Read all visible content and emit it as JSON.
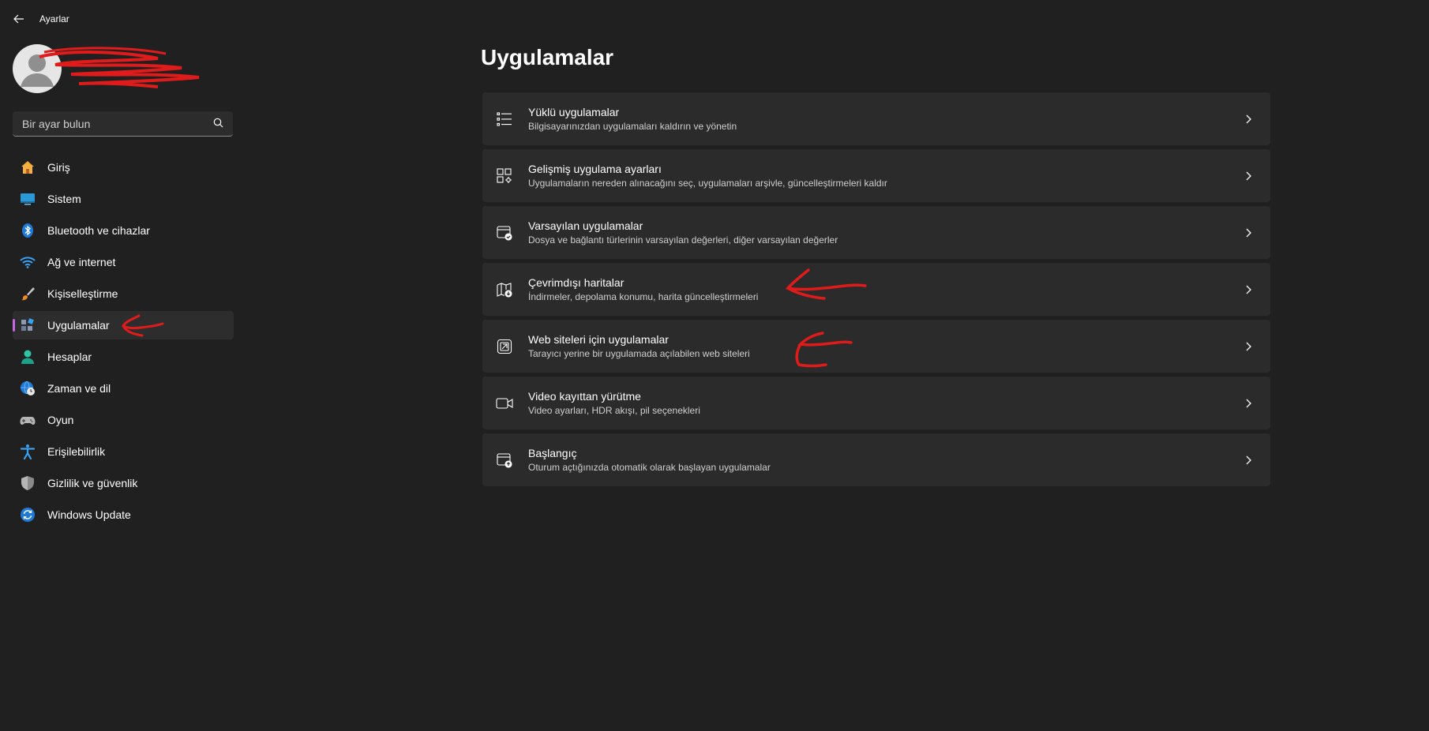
{
  "window": {
    "title": "Ayarlar"
  },
  "search": {
    "placeholder": "Bir ayar bulun"
  },
  "sidebar": {
    "items": [
      {
        "label": "Giriş",
        "icon": "home-icon"
      },
      {
        "label": "Sistem",
        "icon": "monitor-icon"
      },
      {
        "label": "Bluetooth ve cihazlar",
        "icon": "bluetooth-icon"
      },
      {
        "label": "Ağ ve internet",
        "icon": "wifi-icon"
      },
      {
        "label": "Kişiselleştirme",
        "icon": "brush-icon"
      },
      {
        "label": "Uygulamalar",
        "icon": "apps-icon",
        "selected": true
      },
      {
        "label": "Hesaplar",
        "icon": "person-icon"
      },
      {
        "label": "Zaman ve dil",
        "icon": "globe-clock-icon"
      },
      {
        "label": "Oyun",
        "icon": "gamepad-icon"
      },
      {
        "label": "Erişilebilirlik",
        "icon": "accessibility-icon"
      },
      {
        "label": "Gizlilik ve güvenlik",
        "icon": "shield-icon"
      },
      {
        "label": "Windows Update",
        "icon": "sync-icon"
      }
    ]
  },
  "main": {
    "title": "Uygulamalar",
    "cards": [
      {
        "title": "Yüklü uygulamalar",
        "desc": "Bilgisayarınızdan uygulamaları kaldırın ve yönetin",
        "icon": "list-icon"
      },
      {
        "title": "Gelişmiş uygulama ayarları",
        "desc": "Uygulamaların nereden alınacağını seç, uygulamaları arşivle, güncelleştirmeleri kaldır",
        "icon": "apps-settings-icon"
      },
      {
        "title": "Varsayılan uygulamalar",
        "desc": "Dosya ve bağlantı türlerinin varsayılan değerleri, diğer varsayılan değerler",
        "icon": "default-apps-icon"
      },
      {
        "title": "Çevrimdışı haritalar",
        "desc": "İndirmeler, depolama konumu, harita güncelleştirmeleri",
        "icon": "map-download-icon"
      },
      {
        "title": "Web siteleri için uygulamalar",
        "desc": "Tarayıcı yerine bir uygulamada açılabilen web siteleri",
        "icon": "open-in-app-icon"
      },
      {
        "title": "Video kayıttan yürütme",
        "desc": "Video ayarları, HDR akışı, pil seçenekleri",
        "icon": "video-icon"
      },
      {
        "title": "Başlangıç",
        "desc": "Oturum açtığınızda otomatik olarak başlayan uygulamalar",
        "icon": "startup-icon"
      }
    ]
  },
  "colors": {
    "background": "#202020",
    "card": "#2b2b2b",
    "accent": "#c567e6",
    "annotation": "#e01b1b"
  }
}
